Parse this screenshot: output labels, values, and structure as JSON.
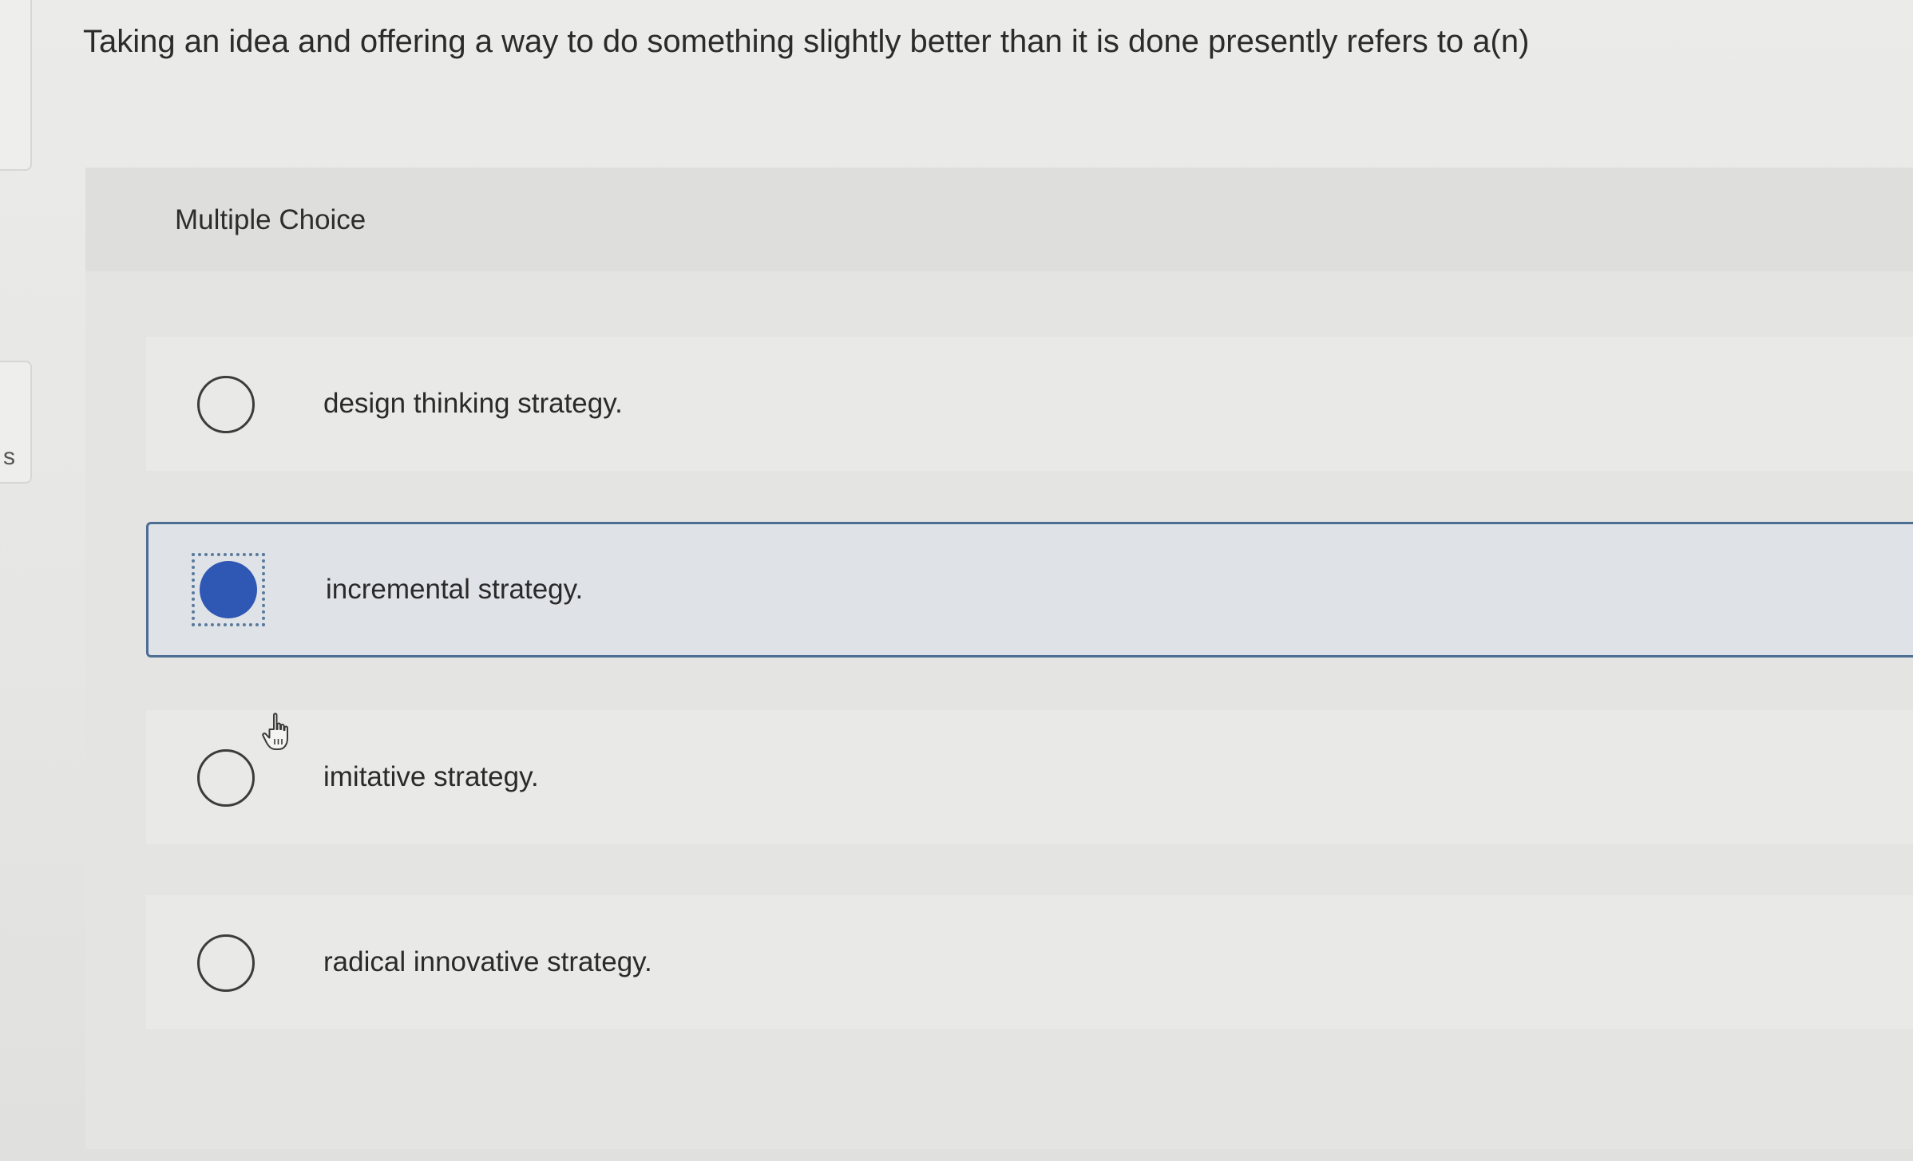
{
  "question": {
    "text": "Taking an idea and offering a way to do something slightly better than it is done presently refers to a(n)"
  },
  "panel": {
    "title": "Multiple Choice"
  },
  "left_edge": {
    "glyph": "s"
  },
  "options": [
    {
      "label": "design thinking strategy.",
      "selected": false
    },
    {
      "label": "incremental strategy.",
      "selected": true
    },
    {
      "label": "imitative strategy.",
      "selected": false
    },
    {
      "label": "radical innovative strategy.",
      "selected": false
    }
  ],
  "colors": {
    "selected_fill": "#2f57b4",
    "selected_border": "#4d6e93",
    "selected_background": "#dfe3e8",
    "text": "#2d2d2d"
  },
  "icons": {
    "cursor": "hand-pointer-icon"
  }
}
